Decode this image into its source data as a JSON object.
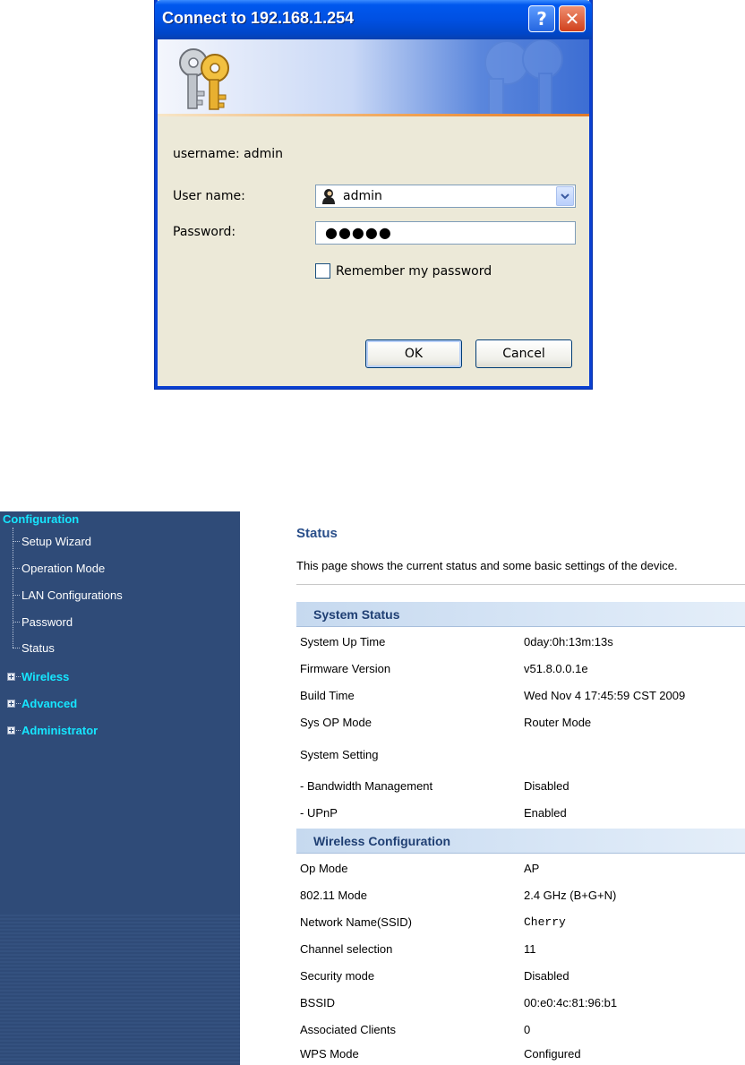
{
  "dialog": {
    "title": "Connect to 192.168.1.254",
    "help_glyph": "?",
    "close_glyph": "✕",
    "realm_text": "username: admin",
    "username_label": "User name:",
    "username_value": "admin",
    "password_label": "Password:",
    "password_value": "●●●●●",
    "remember_label": "Remember my password",
    "remember_checked": false,
    "ok_label": "OK",
    "cancel_label": "Cancel"
  },
  "sidebar": {
    "root": "Configuration",
    "items": [
      {
        "label": "Setup Wizard"
      },
      {
        "label": "Operation Mode"
      },
      {
        "label": "LAN Configurations"
      },
      {
        "label": "Password"
      },
      {
        "label": "Status"
      }
    ],
    "groups": [
      {
        "label": "Wireless"
      },
      {
        "label": "Advanced"
      },
      {
        "label": "Administrator"
      }
    ]
  },
  "main": {
    "title": "Status",
    "description": "This page shows the current status and some basic settings of the device.",
    "system_status": {
      "header": "System Status",
      "rows": [
        {
          "label": "System Up Time",
          "value": "0day:0h:13m:13s"
        },
        {
          "label": "Firmware Version",
          "value": "v51.8.0.0.1e"
        },
        {
          "label": "Build Time",
          "value": "Wed Nov 4 17:45:59 CST 2009"
        },
        {
          "label": "Sys OP Mode",
          "value": "Router Mode"
        },
        {
          "label": "System Setting",
          "value": ""
        },
        {
          "label": "- Bandwidth Management",
          "value": "Disabled"
        },
        {
          "label": "- UPnP",
          "value": "Enabled"
        }
      ]
    },
    "wireless": {
      "header": "Wireless Configuration",
      "rows": [
        {
          "label": "Op Mode",
          "value": "AP"
        },
        {
          "label": "802.11 Mode",
          "value": "2.4 GHz (B+G+N)"
        },
        {
          "label": "Network Name(SSID)",
          "value": "Cherry"
        },
        {
          "label": "Channel selection",
          "value": "11"
        },
        {
          "label": "Security mode",
          "value": "Disabled"
        },
        {
          "label": "BSSID",
          "value": "00:e0:4c:81:96:b1"
        },
        {
          "label": "Associated Clients",
          "value": "0"
        },
        {
          "label": "WPS Mode",
          "value": "Configured"
        }
      ]
    }
  },
  "colors": {
    "titlebar": "#0050e2",
    "sidebar_bg": "#2f4b78",
    "nav_accent": "#16e6ff",
    "section_header": "#c6d9ef"
  }
}
